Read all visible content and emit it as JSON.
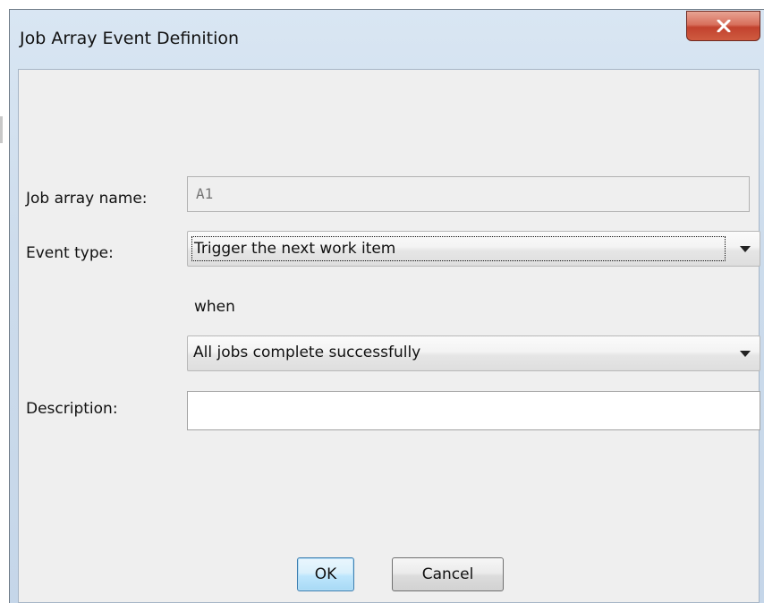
{
  "window": {
    "title": "Job Array Event Definition",
    "close_symbol": "x"
  },
  "form": {
    "job_array_name": {
      "label": "Job array name:",
      "value": "A1",
      "enabled": false
    },
    "event_type": {
      "label": "Event type:",
      "selected": "Trigger the next work item"
    },
    "when_label": "when",
    "condition": {
      "selected": "All jobs complete successfully"
    },
    "description": {
      "label": "Description:",
      "value": ""
    }
  },
  "buttons": {
    "ok": "OK",
    "cancel": "Cancel"
  },
  "colors": {
    "close_button": "#c94a35",
    "dialog_body": "#efefef",
    "title_bar": "#cddcec",
    "default_button_border": "#3c7fb1"
  }
}
